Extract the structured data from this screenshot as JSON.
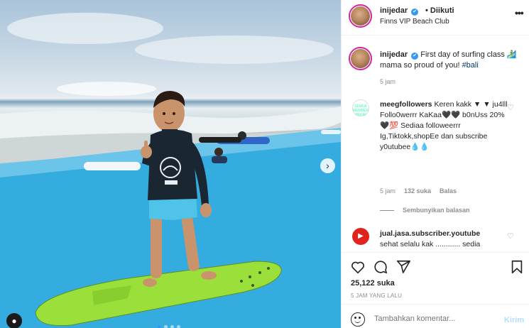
{
  "post": {
    "username": "inijedar",
    "verified_mark": "✔",
    "separator": "•",
    "follow_status": "Diikuti",
    "location": "Finns VIP Beach Club",
    "more_icon": "more-horizontal-icon"
  },
  "caption": {
    "username": "inijedar",
    "text_before": "First day of surfing class 🏄‍♂️ mama so proud of you! ",
    "hashtag": "#bali",
    "time": "5 jam"
  },
  "comments": [
    {
      "username": "meegfollowers",
      "text": "Keren kakk ▼ ▼ ju4lll Follo0werrr KaKaa🖤🖤 b0nUss 20%🖤💯 Sediaa followeerrr Ig,Tiktokk,shopEe dan subscribe y0utubee💧💧",
      "time": "5 jam",
      "likes": "132 suka",
      "reply": "Balas",
      "hide_replies": "Sembunyikan balasan",
      "avatar_text": "SEMUA MEMBER PAKAI"
    },
    {
      "username": "jual.jasa.subscriber.youtube",
      "text": "sehat selalu kak ............ sedia",
      "avatar_text": "▶"
    }
  ],
  "actions": {
    "icons": [
      "heart-icon",
      "comment-icon",
      "share-icon",
      "bookmark-icon"
    ],
    "likes": "25,122 suka",
    "posted": "5 JAM YANG LALU"
  },
  "add_comment": {
    "placeholder": "Tambahkan komentar...",
    "send_label": "Kirim"
  },
  "photo": {
    "next_arrow": "›",
    "user_tag_icon": "user-icon",
    "carousel_count": 4,
    "carousel_active": 1,
    "colors": {
      "water": "#2ea7da",
      "board": "#9be03a",
      "rashguard": "#1b2633",
      "shorts": "#4fc3e8"
    }
  }
}
